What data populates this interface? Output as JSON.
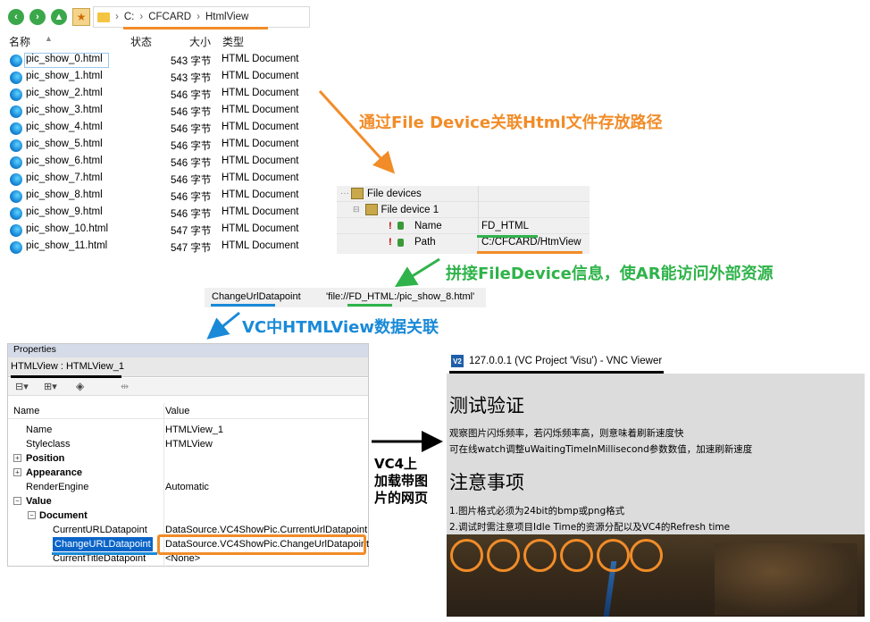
{
  "explorer": {
    "path": [
      "C:",
      "CFCARD",
      "HtmlView"
    ],
    "columns": {
      "name": "名称",
      "status": "状态",
      "size": "大小",
      "type": "类型"
    },
    "files": [
      {
        "name": "pic_show_0.html",
        "size": "543 字节",
        "type": "HTML Document"
      },
      {
        "name": "pic_show_1.html",
        "size": "543 字节",
        "type": "HTML Document"
      },
      {
        "name": "pic_show_2.html",
        "size": "546 字节",
        "type": "HTML Document"
      },
      {
        "name": "pic_show_3.html",
        "size": "546 字节",
        "type": "HTML Document"
      },
      {
        "name": "pic_show_4.html",
        "size": "546 字节",
        "type": "HTML Document"
      },
      {
        "name": "pic_show_5.html",
        "size": "546 字节",
        "type": "HTML Document"
      },
      {
        "name": "pic_show_6.html",
        "size": "546 字节",
        "type": "HTML Document"
      },
      {
        "name": "pic_show_7.html",
        "size": "546 字节",
        "type": "HTML Document"
      },
      {
        "name": "pic_show_8.html",
        "size": "546 字节",
        "type": "HTML Document"
      },
      {
        "name": "pic_show_9.html",
        "size": "546 字节",
        "type": "HTML Document"
      },
      {
        "name": "pic_show_10.html",
        "size": "547 字节",
        "type": "HTML Document"
      },
      {
        "name": "pic_show_11.html",
        "size": "547 字节",
        "type": "HTML Document"
      }
    ]
  },
  "annotations": {
    "a1": "通过File Device关联Html文件存放路径",
    "a2": "拼接FileDevice信息，使AR能访问外部资源",
    "a3": "VC中HTMLView数据关联",
    "a4_l1": "VC4上",
    "a4_l2": "加载带图",
    "a4_l3": "片的网页"
  },
  "file_devices": {
    "root": "File devices",
    "device": "File device 1",
    "rows": [
      {
        "key": "Name",
        "value": "FD_HTML"
      },
      {
        "key": "Path",
        "value": "C:/CFCARD/HtmView"
      }
    ]
  },
  "url_line": {
    "label": "ChangeUrlDatapoint",
    "value": "'file://FD_HTML:/pic_show_8.html'"
  },
  "properties": {
    "title": "Properties",
    "object": "HTMLView : HTMLView_1",
    "header": {
      "name": "Name",
      "value": "Value"
    },
    "rows": [
      {
        "name": "Name",
        "value": "HTMLView_1"
      },
      {
        "name": "Styleclass",
        "value": "HTMLView"
      },
      {
        "name": "Position",
        "value": ""
      },
      {
        "name": "Appearance",
        "value": ""
      },
      {
        "name": "RenderEngine",
        "value": "Automatic"
      },
      {
        "name": "Value",
        "value": ""
      },
      {
        "name": "Document",
        "value": ""
      },
      {
        "name": "CurrentURLDatapoint",
        "value": "DataSource.VC4ShowPic.CurrentUrlDatapoint"
      },
      {
        "name": "ChangeURLDatapoint",
        "value": "DataSource.VC4ShowPic.ChangeUrlDatapoint"
      },
      {
        "name": "CurrentTitleDatapoint",
        "value": "<None>"
      }
    ]
  },
  "vnc": {
    "logo": "V2",
    "title": "127.0.0.1 (VC Project 'Visu') - VNC Viewer",
    "h1": "测试验证",
    "p1": "观察图片闪烁频率，若闪烁频率高，则意味着刷新速度快",
    "p2": "可在线watch调整uWaitingTimeInMillisecond参数数值，加速刷新速度",
    "h2": "注意事项",
    "p3": "1.图片格式必须为24bit的bmp或png格式",
    "p4": "2.调试时需注意项目Idle Time的资源分配以及VC4的Refresh time"
  },
  "colors": {
    "orange": "#f28c28",
    "green": "#2fb34a",
    "blue": "#1a8ad8",
    "black": "#000000"
  }
}
